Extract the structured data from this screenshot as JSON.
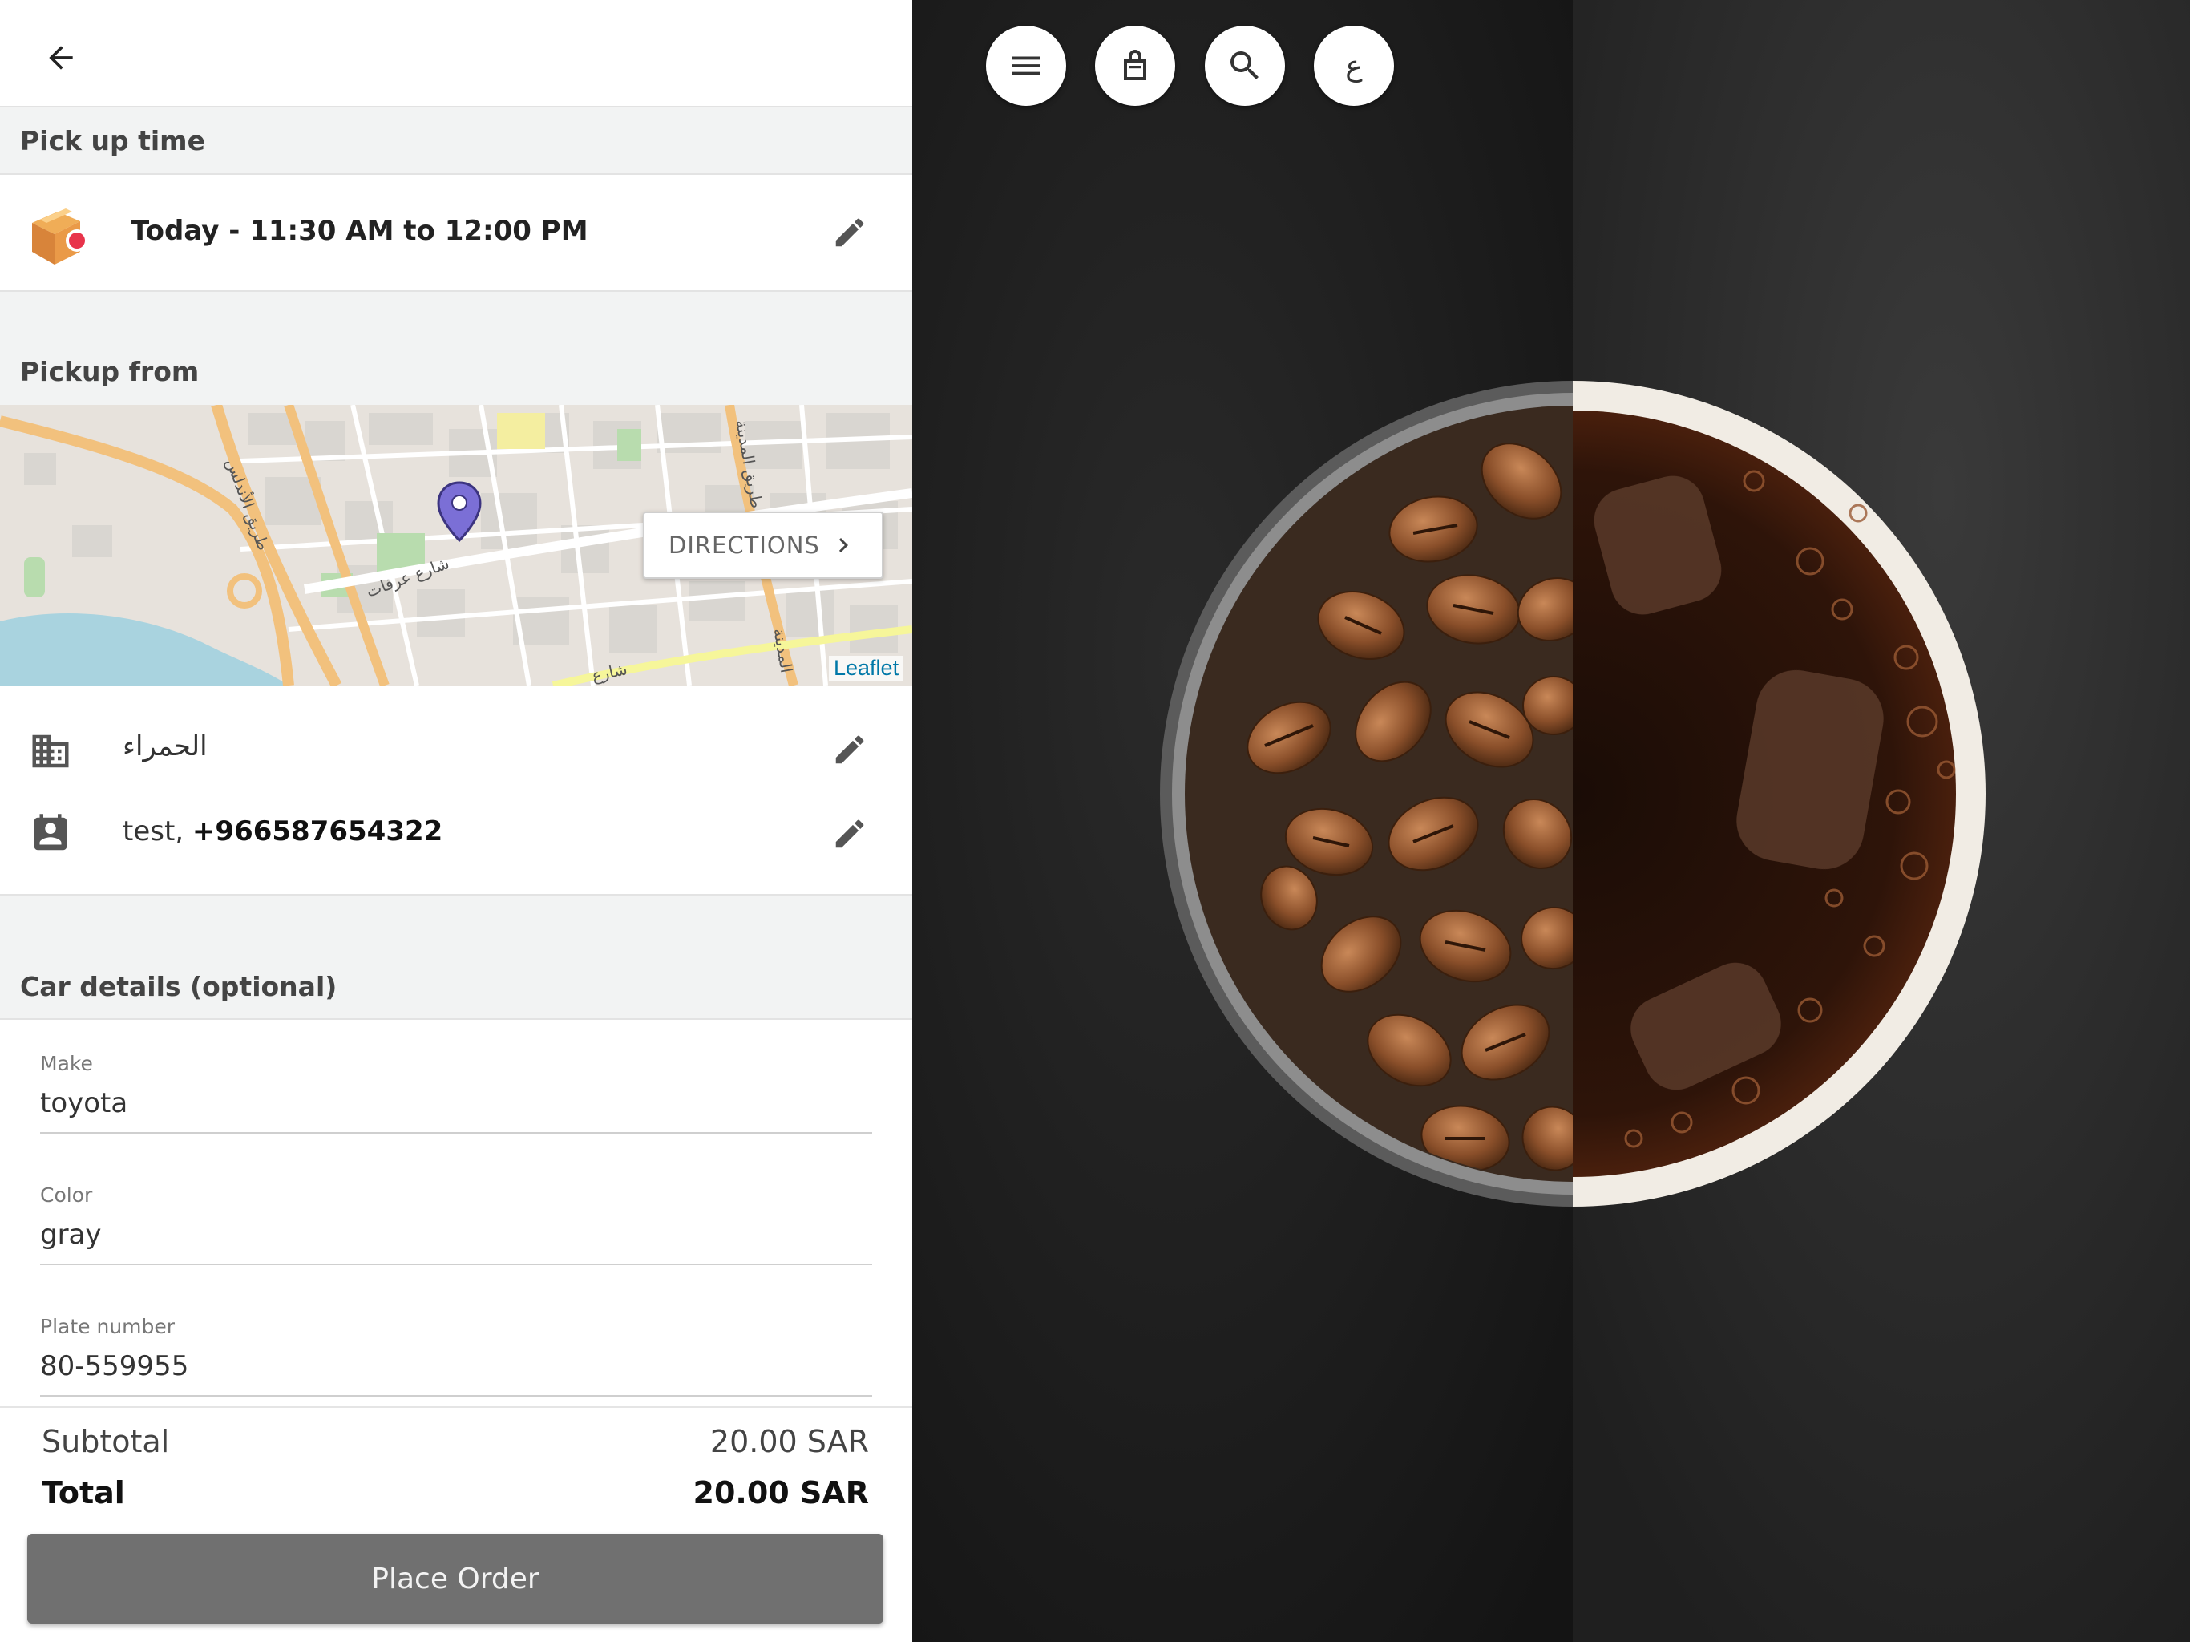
{
  "header": {
    "back_icon": "arrow-back-icon"
  },
  "pickup_time": {
    "section_title": "Pick up time",
    "value": "Today - 11:30 AM to 12:00 PM",
    "icon": "package-box-icon"
  },
  "pickup_from": {
    "section_title": "Pickup from",
    "directions_label": "DIRECTIONS",
    "map_attribution": "Leaflet",
    "map_street_labels": [
      "طريق الأندلس",
      "شارع عرفات",
      "شارع",
      "طريق المدينة",
      "المدينة"
    ],
    "branch_name": "الحمراء",
    "contact_name": "test, ",
    "contact_phone": "+966587654322"
  },
  "car_details": {
    "section_title": "Car details (optional)",
    "make_label": "Make",
    "make_value": "toyota",
    "color_label": "Color",
    "color_value": "gray",
    "plate_label": "Plate number",
    "plate_value": "80-559955"
  },
  "summary": {
    "subtotal_label": "Subtotal",
    "subtotal_value": "20.00 SAR",
    "total_label": "Total",
    "total_value": "20.00 SAR",
    "place_order_label": "Place Order"
  },
  "right_nav": {
    "language_label": "ع",
    "icons": [
      "menu-icon",
      "shopping-bag-icon",
      "search-icon"
    ]
  },
  "colors": {
    "header_bg": "#f2f3f3",
    "button_bg": "#707070",
    "link": "#0078a8",
    "map_pin": "#7b6fd6",
    "hero_bg": "#1d1d1d"
  }
}
